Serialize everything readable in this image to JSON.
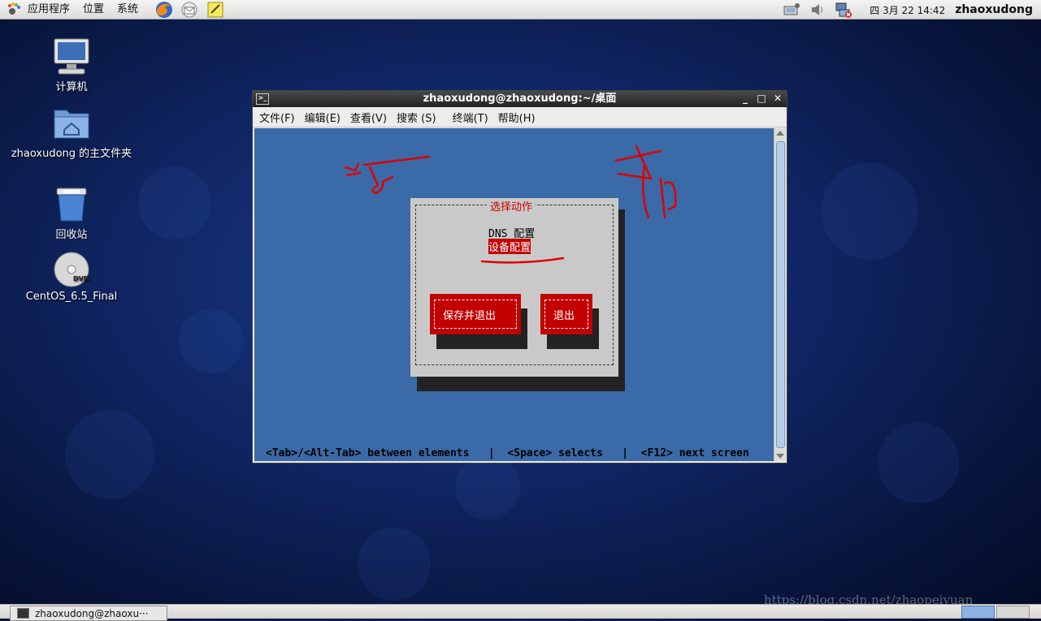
{
  "top_panel": {
    "menus": [
      "应用程序",
      "位置",
      "系统"
    ],
    "clock": "四 3月 22 14:42",
    "user": "zhaoxudong"
  },
  "desktop": {
    "icons": [
      {
        "label": "计算机",
        "icon": "computer-icon"
      },
      {
        "label": "zhaoxudong 的主文件夹",
        "icon": "home-folder-icon"
      },
      {
        "label": "回收站",
        "icon": "trash-icon"
      },
      {
        "label": "CentOS_6.5_Final",
        "icon": "dvd-icon"
      }
    ]
  },
  "terminal": {
    "title": "zhaoxudong@zhaoxudong:~/桌面",
    "menu": [
      "文件(F)",
      "编辑(E)",
      "查看(V)",
      "搜索 (S)",
      "终端(T)",
      "帮助(H)"
    ],
    "dialog": {
      "title": "选择动作",
      "options": [
        "DNS 配置",
        "设备配置"
      ],
      "selected_index": 1,
      "buttons": [
        "保存并退出",
        "退出"
      ]
    },
    "hint": "<Tab>/<Alt-Tab> between elements   |  <Space> selects   |  <F12> next screen"
  },
  "taskbar": {
    "item": "zhaoxudong@zhaoxu···"
  },
  "watermark": "https://blog.csdn.net/zhaopeiyuan",
  "colors": {
    "selection": "#c30000",
    "terminal_bg": "#3a6aa8",
    "dialog_bg": "#c9c9c9",
    "annotation": "#e00000"
  }
}
